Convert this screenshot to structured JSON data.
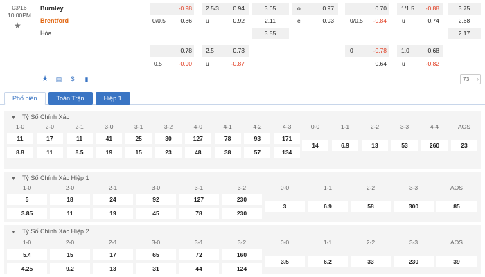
{
  "match": {
    "date": "03/16",
    "time": "10:00PM",
    "home": "Burnley",
    "away": "Brentford",
    "draw": "Hòa",
    "count": "73"
  },
  "odds": {
    "row1": {
      "h1": "-0.98",
      "ou1": "2.5/3",
      "ou1v": "0.94",
      "x12": "3.05",
      "oeA": "o",
      "oeAv": "0.97",
      "h2v": "0.70",
      "h2l": "1/1.5",
      "h2v2": "-0.88",
      "x12b": "3.75"
    },
    "row2": {
      "hl": "0/0.5",
      "hv": "0.86",
      "ul": "u",
      "uv": "0.92",
      "x12": "2.11",
      "oeB": "e",
      "oeBv": "0.93",
      "h2l": "0/0.5",
      "h2v": "-0.84",
      "ul2": "u",
      "uv2": "0.74",
      "x12b": "2.68"
    },
    "row3": {
      "x12": "3.55",
      "x12b": "2.17"
    },
    "row4": {
      "hv": "0.78",
      "ol": "2.5",
      "ov": "0.73",
      "h2l": "0",
      "h2v": "-0.78",
      "ol2": "1.0",
      "ov2": "0.68"
    },
    "row5": {
      "hl": "0.5",
      "hv": "-0.90",
      "ul": "u",
      "uv": "-0.87",
      "h2v": "0.64",
      "ul2": "u",
      "uv2": "-0.82"
    }
  },
  "tabs": [
    "Phổ biến",
    "Toàn Trận",
    "Hiệp 1"
  ],
  "sections": [
    {
      "title": "Tỷ Số Chính Xác",
      "home_scores": [
        "1-0",
        "2-0",
        "2-1",
        "3-0",
        "3-1",
        "3-2",
        "4-0",
        "4-1",
        "4-2",
        "4-3"
      ],
      "home_odds": [
        "11",
        "17",
        "11",
        "41",
        "25",
        "30",
        "127",
        "78",
        "93",
        "171"
      ],
      "away_odds": [
        "8.8",
        "11",
        "8.5",
        "19",
        "15",
        "23",
        "48",
        "38",
        "57",
        "134"
      ],
      "draw_scores": [
        "0-0",
        "1-1",
        "2-2",
        "3-3",
        "4-4",
        "AOS"
      ],
      "draw_odds": [
        "14",
        "6.9",
        "13",
        "53",
        "260",
        "23"
      ]
    },
    {
      "title": "Tỷ Số Chính Xác Hiệp 1",
      "home_scores": [
        "1-0",
        "2-0",
        "2-1",
        "3-0",
        "3-1",
        "3-2"
      ],
      "home_odds": [
        "5",
        "18",
        "24",
        "92",
        "127",
        "230"
      ],
      "away_odds": [
        "3.85",
        "11",
        "19",
        "45",
        "78",
        "230"
      ],
      "draw_scores": [
        "0-0",
        "1-1",
        "2-2",
        "3-3",
        "AOS"
      ],
      "draw_odds": [
        "3",
        "6.9",
        "58",
        "300",
        "85"
      ]
    },
    {
      "title": "Tỷ Số Chính Xác Hiệp 2",
      "home_scores": [
        "1-0",
        "2-0",
        "2-1",
        "3-0",
        "3-1",
        "3-2"
      ],
      "home_odds": [
        "5.4",
        "15",
        "17",
        "65",
        "72",
        "160"
      ],
      "away_odds": [
        "4.25",
        "9.2",
        "13",
        "31",
        "44",
        "124"
      ],
      "draw_scores": [
        "0-0",
        "1-1",
        "2-2",
        "3-3",
        "AOS"
      ],
      "draw_odds": [
        "3.5",
        "6.2",
        "33",
        "230",
        "39"
      ]
    }
  ]
}
